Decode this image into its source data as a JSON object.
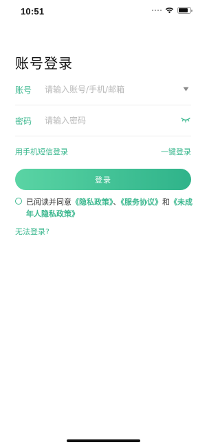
{
  "status_bar": {
    "time": "10:51",
    "battery_level": 0.8
  },
  "title": "账号登录",
  "account": {
    "label": "账号",
    "placeholder": "请输入账号/手机/邮箱",
    "value": "",
    "icon": "dropdown-triangle"
  },
  "password": {
    "label": "密码",
    "placeholder": "请输入密码",
    "value": "",
    "icon": "eye-closed"
  },
  "links": {
    "sms_login": "用手机短信登录",
    "one_key_login": "一键登录",
    "cannot_login": "无法登录?"
  },
  "login_button": "登录",
  "agreement": {
    "prefix": "已阅读并同意",
    "privacy": "《隐私政策》",
    "sep1": "、",
    "service": "《服务协议》",
    "sep2": "和",
    "minor": "《未成年人隐私政策》",
    "checked": false
  },
  "colors": {
    "accent": "#3cb88f",
    "button_start": "#5ad4a4",
    "button_end": "#2fb38a"
  }
}
